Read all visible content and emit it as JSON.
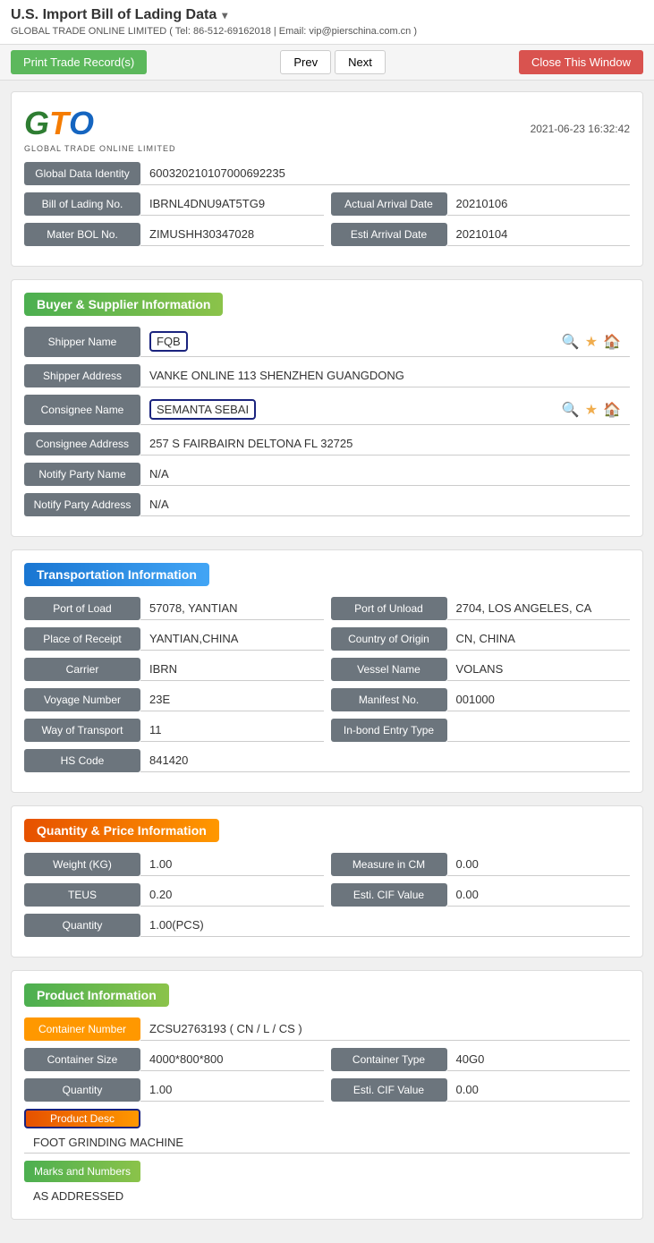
{
  "header": {
    "title": "U.S. Import Bill of Lading Data",
    "subtitle": "GLOBAL TRADE ONLINE LIMITED ( Tel: 86-512-69162018 | Email: vip@pierschina.com.cn )",
    "timestamp": "2021-06-23 16:32:42"
  },
  "toolbar": {
    "print_label": "Print Trade Record(s)",
    "prev_label": "Prev",
    "next_label": "Next",
    "close_label": "Close This Window"
  },
  "logo": {
    "company_name": "GLOBAL TRADE ONLINE LIMITED"
  },
  "identity": {
    "global_data_identity_label": "Global Data Identity",
    "global_data_identity_value": "600320210107000692235",
    "bol_no_label": "Bill of Lading No.",
    "bol_no_value": "IBRNL4DNU9AT5TG9",
    "actual_arrival_date_label": "Actual Arrival Date",
    "actual_arrival_date_value": "20210106",
    "mater_bol_label": "Mater BOL No.",
    "mater_bol_value": "ZIMUSHH30347028",
    "esti_arrival_date_label": "Esti Arrival Date",
    "esti_arrival_date_value": "20210104"
  },
  "buyer_supplier": {
    "section_title": "Buyer & Supplier Information",
    "shipper_name_label": "Shipper Name",
    "shipper_name_value": "FQB",
    "shipper_address_label": "Shipper Address",
    "shipper_address_value": "VANKE ONLINE 113 SHENZHEN GUANGDONG",
    "consignee_name_label": "Consignee Name",
    "consignee_name_value": "SEMANTA SEBAI",
    "consignee_address_label": "Consignee Address",
    "consignee_address_value": "257 S FAIRBAIRN DELTONA FL 32725",
    "notify_party_name_label": "Notify Party Name",
    "notify_party_name_value": "N/A",
    "notify_party_address_label": "Notify Party Address",
    "notify_party_address_value": "N/A"
  },
  "transportation": {
    "section_title": "Transportation Information",
    "port_of_load_label": "Port of Load",
    "port_of_load_value": "57078, YANTIAN",
    "port_of_unload_label": "Port of Unload",
    "port_of_unload_value": "2704, LOS ANGELES, CA",
    "place_of_receipt_label": "Place of Receipt",
    "place_of_receipt_value": "YANTIAN,CHINA",
    "country_of_origin_label": "Country of Origin",
    "country_of_origin_value": "CN, CHINA",
    "carrier_label": "Carrier",
    "carrier_value": "IBRN",
    "vessel_name_label": "Vessel Name",
    "vessel_name_value": "VOLANS",
    "voyage_number_label": "Voyage Number",
    "voyage_number_value": "23E",
    "manifest_no_label": "Manifest No.",
    "manifest_no_value": "001000",
    "way_of_transport_label": "Way of Transport",
    "way_of_transport_value": "11",
    "in_bond_entry_type_label": "In-bond Entry Type",
    "in_bond_entry_type_value": "",
    "hs_code_label": "HS Code",
    "hs_code_value": "841420"
  },
  "quantity_price": {
    "section_title": "Quantity & Price Information",
    "weight_label": "Weight (KG)",
    "weight_value": "1.00",
    "measure_in_cm_label": "Measure in CM",
    "measure_in_cm_value": "0.00",
    "teus_label": "TEUS",
    "teus_value": "0.20",
    "esti_cif_value_label": "Esti. CIF Value",
    "esti_cif_value": "0.00",
    "quantity_label": "Quantity",
    "quantity_value": "1.00(PCS)"
  },
  "product_info": {
    "section_title": "Product Information",
    "container_number_label": "Container Number",
    "container_number_value": "ZCSU2763193 ( CN / L / CS )",
    "container_size_label": "Container Size",
    "container_size_value": "4000*800*800",
    "container_type_label": "Container Type",
    "container_type_value": "40G0",
    "quantity_label": "Quantity",
    "quantity_value": "1.00",
    "esti_cif_value_label": "Esti. CIF Value",
    "esti_cif_value": "0.00",
    "product_desc_label": "Product Desc",
    "product_desc_value": "FOOT GRINDING MACHINE",
    "marks_and_numbers_label": "Marks and Numbers",
    "marks_and_numbers_value": "AS ADDRESSED"
  }
}
